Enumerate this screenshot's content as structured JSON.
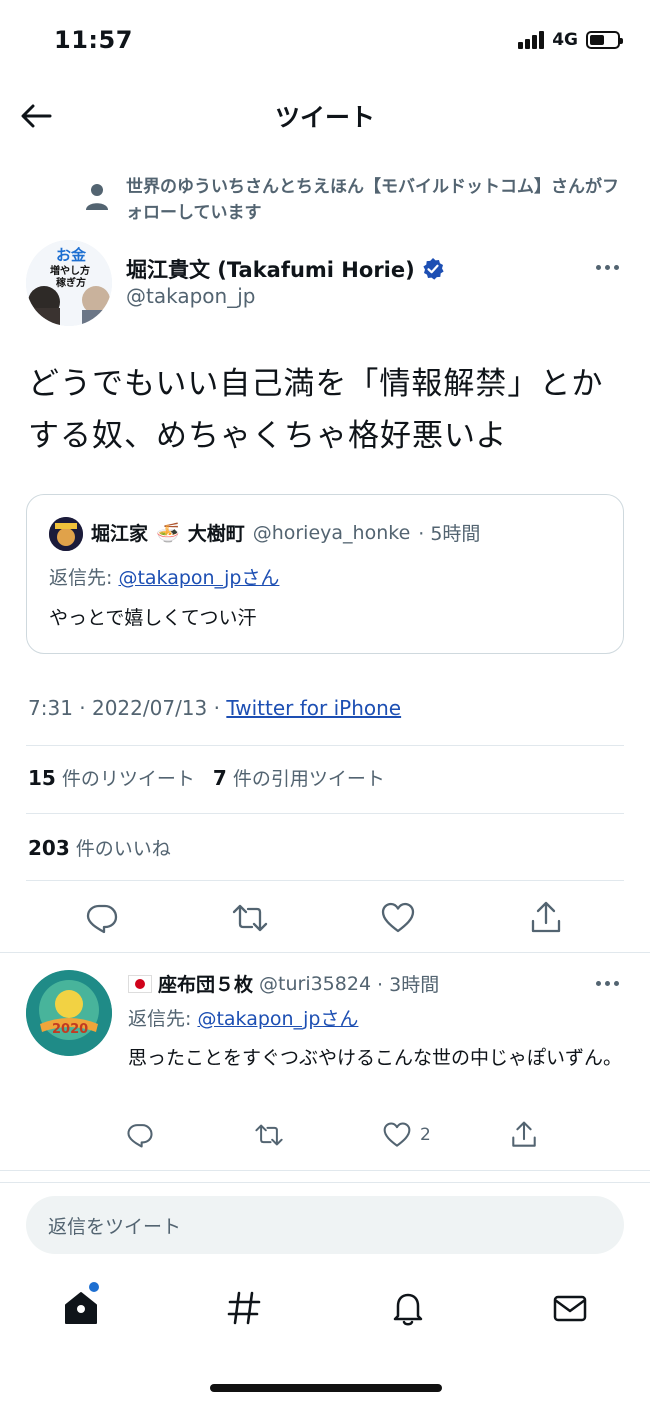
{
  "status_bar": {
    "time": "11:57",
    "network": "4G"
  },
  "header": {
    "title": "ツイート"
  },
  "social_context": {
    "text": "世界のゆういちさんとちえほん【モバイルドットコム】さんがフォローしています"
  },
  "author": {
    "name": "堀江貴文 (Takafumi Horie)",
    "handle": "@takapon_jp",
    "avatar_text_1": "お金",
    "avatar_text_2": "増やし方",
    "avatar_text_3": "稼ぎ方"
  },
  "tweet": {
    "text": "どうでもいい自己満を「情報解禁」とかする奴、めちゃくちゃ格好悪いよ"
  },
  "quote": {
    "name": "堀江家",
    "name_emoji": "🍜",
    "name_suffix": "大樹町",
    "handle": "@horieya_honke",
    "time": "· 5時間",
    "reply_prefix": "返信先: ",
    "reply_to": "@takapon_jpさん",
    "text": "やっとで嬉しくてつい汗"
  },
  "meta": {
    "time_date": "7:31 · 2022/07/13 · ",
    "source": "Twitter for iPhone"
  },
  "stats": {
    "retweets_count": "15",
    "retweets_label": "件のリツイート",
    "quotes_count": "7",
    "quotes_label": "件の引用ツイート",
    "likes_count": "203",
    "likes_label": "件のいいね"
  },
  "reply": {
    "name": "座布団５枚",
    "handle": "@turi35824",
    "time": "· 3時間",
    "reply_prefix": "返信先: ",
    "reply_to": "@takapon_jpさん",
    "text": "思ったことをすぐつぶやけるこんな世の中じゃぽいずん。",
    "likes": "2",
    "avatar_text": "2020"
  },
  "composer": {
    "placeholder": "返信をツイート"
  },
  "tabs": [
    "home-icon",
    "explore-icon",
    "notifications-icon",
    "messages-icon"
  ],
  "colors": {
    "link": "#1d4fb3",
    "secondary": "#536471",
    "verified": "#1d4fb3"
  }
}
